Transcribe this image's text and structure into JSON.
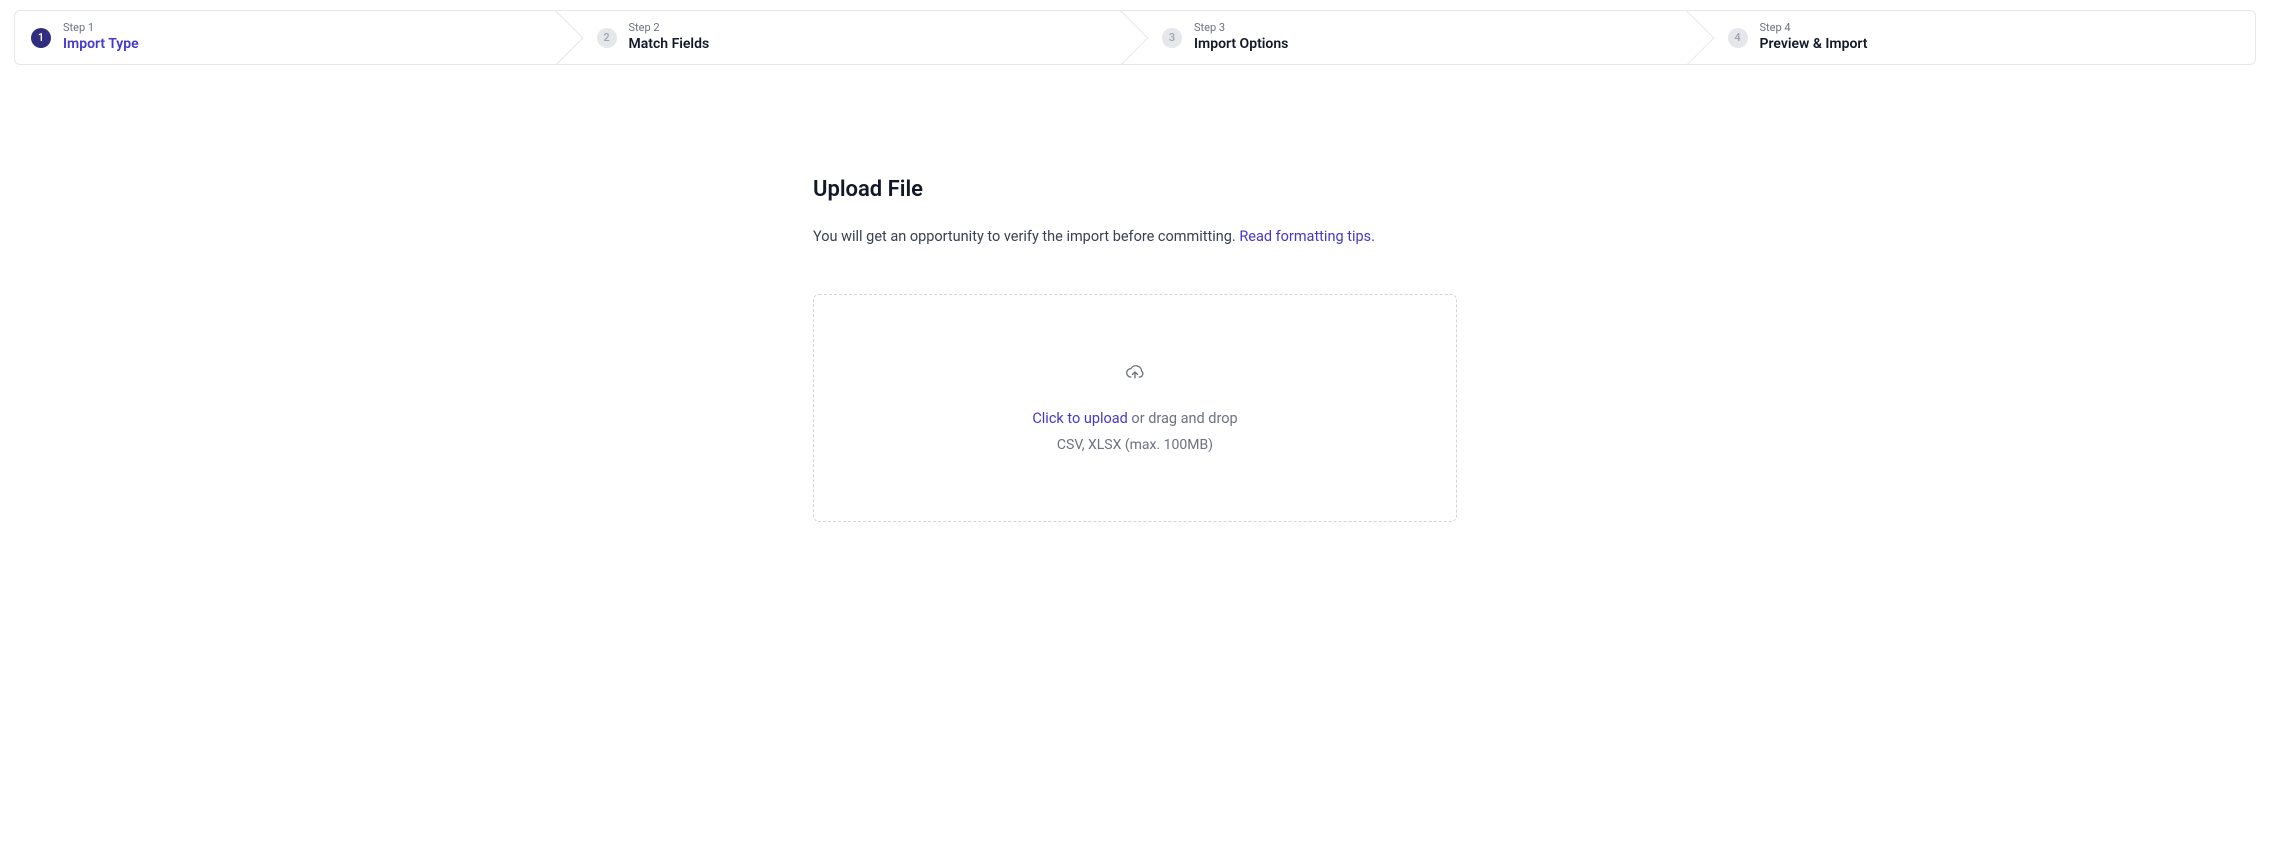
{
  "stepper": {
    "steps": [
      {
        "num": "1",
        "smallLabel": "Step 1",
        "title": "Import Type",
        "state": "current"
      },
      {
        "num": "2",
        "smallLabel": "Step 2",
        "title": "Match Fields",
        "state": "upcoming"
      },
      {
        "num": "3",
        "smallLabel": "Step 3",
        "title": "Import Options",
        "state": "upcoming"
      },
      {
        "num": "4",
        "smallLabel": "Step 4",
        "title": "Preview & Import",
        "state": "upcoming"
      }
    ]
  },
  "upload": {
    "title": "Upload File",
    "descriptionPrefix": "You will get an opportunity to verify the import before committing. ",
    "formattingLinkText": "Read formatting tips",
    "descriptionSuffix": ".",
    "ctaText": "Click to upload",
    "ctaSuffix": " or drag and drop",
    "fileHint": "CSV, XLSX (max. 100MB)"
  }
}
